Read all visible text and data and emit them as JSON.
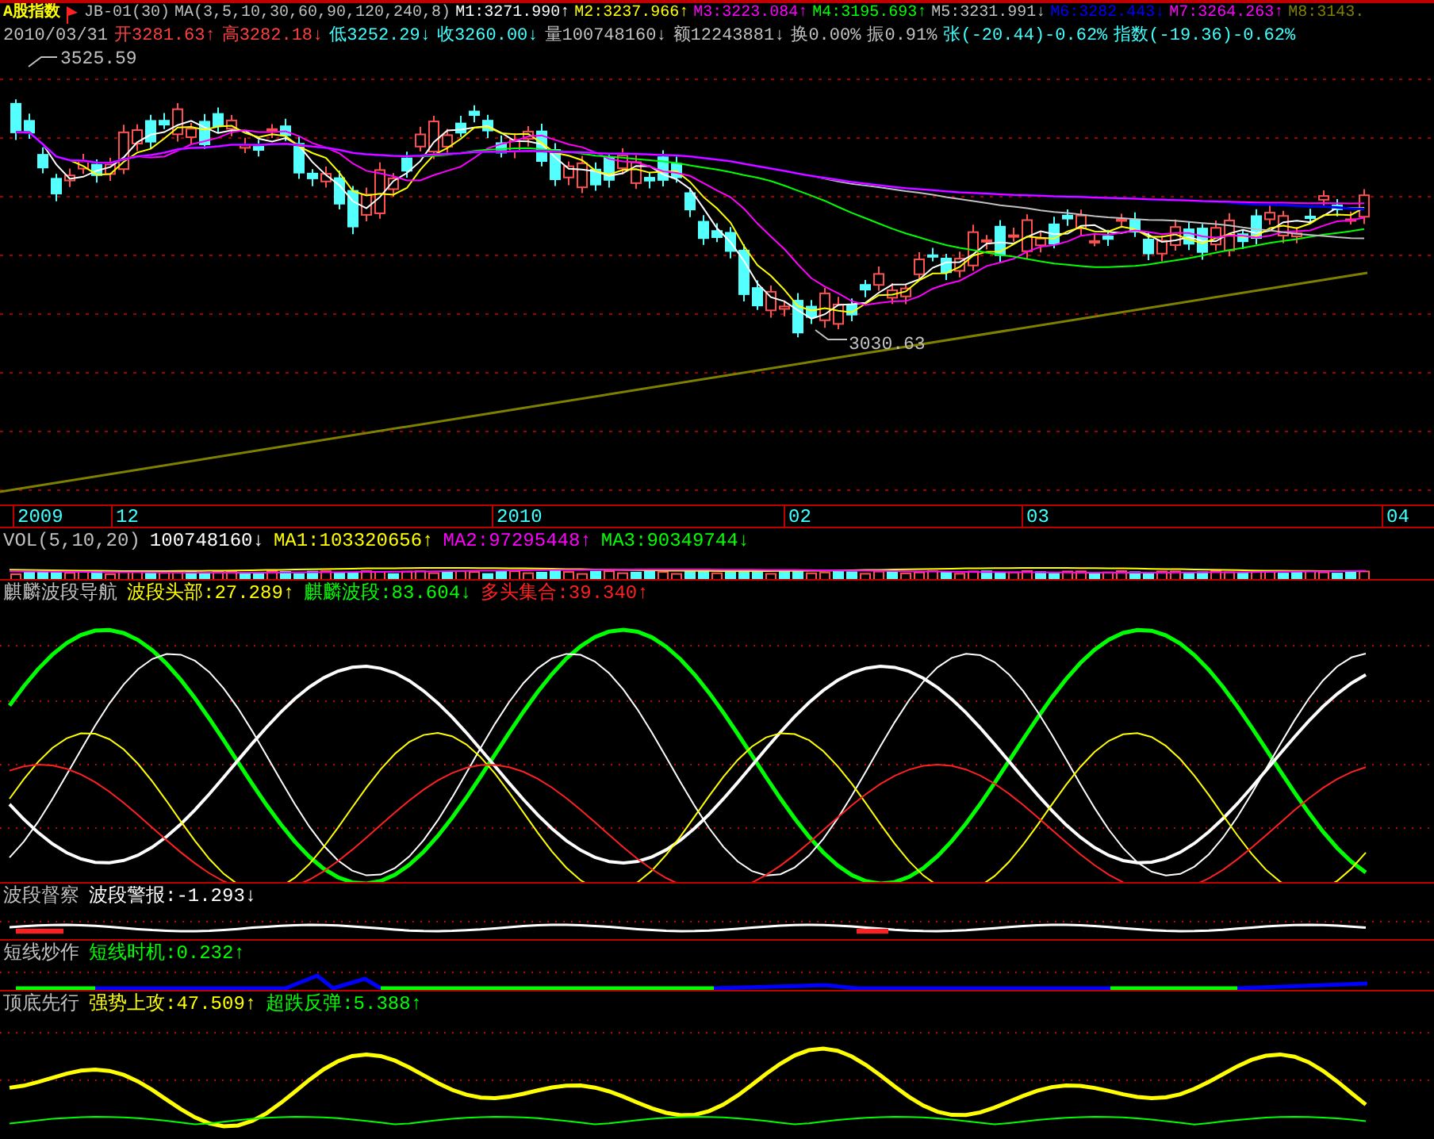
{
  "header": {
    "title": "A股指数",
    "code": "JB-01(30)",
    "ma_params": "MA(3,5,10,30,60,90,120,240,8)",
    "ma_values": [
      {
        "label": "M1:3271.990",
        "arrow": "↑",
        "color": "#ffffff"
      },
      {
        "label": "M2:3237.966",
        "arrow": "↑",
        "color": "#ffff00"
      },
      {
        "label": "M3:3223.084",
        "arrow": "↑",
        "color": "#ff00ff"
      },
      {
        "label": "M4:3195.693",
        "arrow": "↑",
        "color": "#00ff00"
      },
      {
        "label": "M5:3231.991",
        "arrow": "↓",
        "color": "#c0c0c0"
      },
      {
        "label": "M6:3282.443",
        "arrow": "↓",
        "color": "#0000ff"
      },
      {
        "label": "M7:3264.263",
        "arrow": "↑",
        "color": "#ff00ff"
      },
      {
        "label": "M8:3143.",
        "color": "#808000"
      }
    ]
  },
  "quote": {
    "date": "2010/03/31",
    "items": [
      {
        "label": "开3281.63",
        "arrow": "↑",
        "color": "#ff4040"
      },
      {
        "label": "高3282.18",
        "arrow": "↓",
        "color": "#ff4040"
      },
      {
        "label": "低3252.29",
        "arrow": "↓",
        "color": "#40ffff"
      },
      {
        "label": "收3260.00",
        "arrow": "↓",
        "color": "#40ffff"
      },
      {
        "label": "量100748160",
        "arrow": "↓",
        "color": "#c0c0c0"
      },
      {
        "label": "额12243881",
        "arrow": "↓",
        "color": "#c0c0c0"
      },
      {
        "label": "换0.00%",
        "color": "#c0c0c0"
      },
      {
        "label": "振0.91%",
        "color": "#c0c0c0"
      },
      {
        "label": "张(-20.44)-0.62%",
        "color": "#40ffff"
      },
      {
        "label": "指数(-19.36)-0.62%",
        "color": "#40ffff"
      }
    ]
  },
  "price_chart": {
    "high_label": "3525.59",
    "low_label": "3030.63"
  },
  "time_axis": {
    "labels": [
      "2009",
      "12",
      "2010",
      "02",
      "03",
      "04"
    ]
  },
  "panels": [
    {
      "kind": "volume",
      "name": "VOL(5,10,20)",
      "items": [
        {
          "label": "100748160",
          "arrow": "↓",
          "color": "#ffffff"
        },
        {
          "label": "MA1:103320656",
          "arrow": "↑",
          "color": "#ffff00"
        },
        {
          "label": "MA2:97295448",
          "arrow": "↑",
          "color": "#ff00ff"
        },
        {
          "label": "MA3:90349744",
          "arrow": "↓",
          "color": "#00ff00"
        }
      ]
    },
    {
      "kind": "wave",
      "name": "麒麟波段导航",
      "items": [
        {
          "label": "波段头部:27.289",
          "arrow": "↑",
          "color": "#ffff00"
        },
        {
          "label": "麒麟波段:83.604",
          "arrow": "↓",
          "color": "#00ff00"
        },
        {
          "label": "多头集合:39.340",
          "arrow": "↑",
          "color": "#ff2020"
        }
      ]
    },
    {
      "kind": "alarm",
      "name": "波段督察",
      "items": [
        {
          "label": "波段警报:-1.293",
          "arrow": "↓",
          "color": "#ffffff"
        }
      ]
    },
    {
      "kind": "timing",
      "name": "短线炒作",
      "items": [
        {
          "label": "短线时机:0.232",
          "arrow": "↑",
          "color": "#00ff00"
        }
      ]
    },
    {
      "kind": "lead",
      "name": "顶底先行",
      "items": [
        {
          "label": "强势上攻:47.509",
          "arrow": "↑",
          "color": "#ffff00"
        },
        {
          "label": "超跌反弹:5.388",
          "arrow": "↑",
          "color": "#00ff00"
        }
      ]
    }
  ]
}
